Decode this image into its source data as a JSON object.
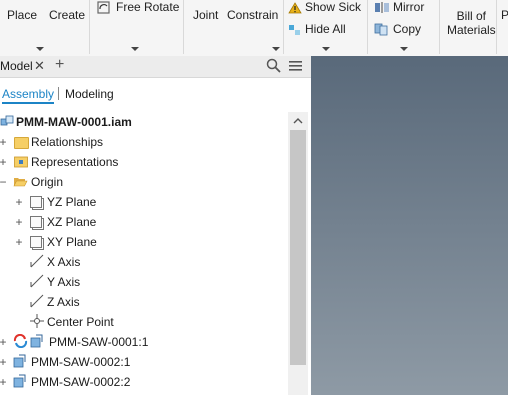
{
  "ribbon": {
    "place": "Place",
    "create": "Create",
    "free_rotate": "Free Rotate",
    "joint": "Joint",
    "constrain": "Constrain",
    "show_sick": "Show Sick",
    "hide_all": "Hide All",
    "mirror": "Mirror",
    "copy": "Copy",
    "bom_line1": "Bill of",
    "bom_line2": "Materials",
    "cut_off": "P"
  },
  "browser": {
    "tab_label": "Model",
    "close_glyph": "✕",
    "add_glyph": "+",
    "assembly": "Assembly",
    "modeling": "Modeling"
  },
  "tree": {
    "root": "PMM-MAW-0001.iam",
    "relationships": "Relationships",
    "representations": "Representations",
    "origin": "Origin",
    "yz_plane": "YZ Plane",
    "xz_plane": "XZ Plane",
    "xy_plane": "XY Plane",
    "x_axis": "X Axis",
    "y_axis": "Y Axis",
    "z_axis": "Z Axis",
    "center_point": "Center Point",
    "part1": "PMM-SAW-0001:1",
    "part2": "PMM-SAW-0002:1",
    "part3": "PMM-SAW-0002:2"
  },
  "colors": {
    "accent": "#1c84c6",
    "viewport_top": "#59697a",
    "viewport_bottom": "#8e9aa5",
    "folder": "#f6cf66",
    "warning": "#e8b21b",
    "update_red": "#e0322b",
    "update_blue": "#2a8ad4"
  }
}
